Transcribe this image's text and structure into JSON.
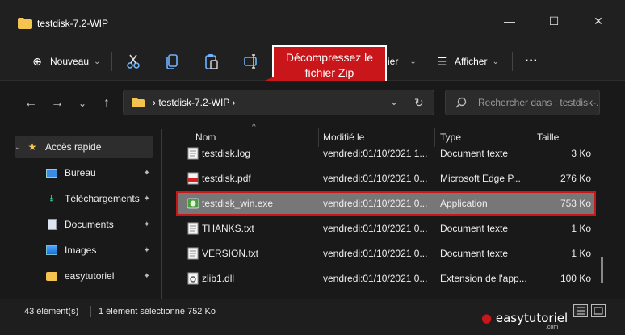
{
  "window": {
    "title": "testdisk-7.2-WIP",
    "minimize": "—",
    "maximize": "☐",
    "close": "✕"
  },
  "commands": {
    "new_label": "Nouveau",
    "new_chevron": "⌄",
    "share_partial": "ier",
    "share_chevron": "⌄",
    "view_label": "Afficher",
    "view_chevron": "⌄",
    "more": "···"
  },
  "address": {
    "breadcrumb": "› testdisk-7.2-WIP ›",
    "dropdown": "⌄",
    "refresh": "↻",
    "search_placeholder": "Rechercher dans : testdisk-..."
  },
  "nav": {
    "back": "←",
    "forward": "→",
    "recent": "⌄",
    "up": "↑"
  },
  "callout": {
    "line1": "Décompressez le",
    "line2": "fichier Zip"
  },
  "sidebar": {
    "items": [
      {
        "label": "Accès rapide",
        "icon": "star-icon",
        "expander": "⌄"
      },
      {
        "label": "Bureau",
        "icon": "desktop-icon",
        "pin": "📌"
      },
      {
        "label": "Téléchargements",
        "icon": "download-icon",
        "pin": "📌"
      },
      {
        "label": "Documents",
        "icon": "documents-icon",
        "pin": "📌"
      },
      {
        "label": "Images",
        "icon": "images-icon",
        "pin": "📌"
      },
      {
        "label": "easytutoriel",
        "icon": "folder-icon",
        "pin": "📌"
      }
    ]
  },
  "columns": {
    "name": "Nom",
    "modified": "Modifié le",
    "type": "Type",
    "size": "Taille",
    "sort_indicator": "^"
  },
  "files": [
    {
      "name": "testdisk.log",
      "modified": "vendredi:01/10/2021 1...",
      "type": "Document texte",
      "size": "3 Ko",
      "icon": "text-file-icon"
    },
    {
      "name": "testdisk.pdf",
      "modified": "vendredi:01/10/2021 0...",
      "type": "Microsoft Edge P...",
      "size": "276 Ko",
      "icon": "pdf-file-icon"
    },
    {
      "name": "testdisk_win.exe",
      "modified": "vendredi:01/10/2021 0...",
      "type": "Application",
      "size": "753 Ko",
      "icon": "exe-file-icon"
    },
    {
      "name": "THANKS.txt",
      "modified": "vendredi:01/10/2021 0...",
      "type": "Document texte",
      "size": "1 Ko",
      "icon": "text-file-icon"
    },
    {
      "name": "VERSION.txt",
      "modified": "vendredi:01/10/2021 0...",
      "type": "Document texte",
      "size": "1 Ko",
      "icon": "text-file-icon"
    },
    {
      "name": "zlib1.dll",
      "modified": "vendredi:01/10/2021 0...",
      "type": "Extension de l'app...",
      "size": "100 Ko",
      "icon": "dll-file-icon"
    }
  ],
  "status": {
    "count": "43 élément(s)",
    "selection": "1 élément sélectionné  752 Ko"
  },
  "brand": {
    "name": "easytutoriel",
    "suffix": ".com"
  },
  "colors": {
    "accent": "#c8161a",
    "background": "#191919",
    "selected_row": "#777777"
  }
}
